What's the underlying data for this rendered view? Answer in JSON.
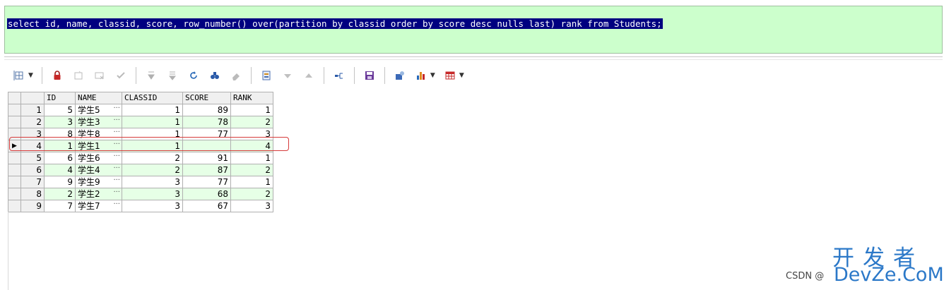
{
  "editor": {
    "sql": "select id, name, classid, score, row_number() over(partition by classid order by score desc nulls last) rank from Students;"
  },
  "toolbar": {
    "icons": [
      "grid-options-icon",
      "lock-icon",
      "insert-record-icon",
      "delete-record-icon",
      "post-check-icon",
      "next-record-icon",
      "last-record-icon",
      "refresh-icon",
      "find-icon",
      "clear-icon",
      "query-by-example-icon",
      "sort-desc-icon",
      "sort-asc-icon",
      "export-icon",
      "save-icon",
      "analyze-icon",
      "chart-icon",
      "table-view-icon"
    ]
  },
  "grid": {
    "columns": [
      "ID",
      "NAME",
      "CLASSID",
      "SCORE",
      "RANK"
    ],
    "ellipsis": "···",
    "current_row_indicator": "▶",
    "rows": [
      {
        "n": "1",
        "id": "5",
        "name": "学生5",
        "classid": "1",
        "score": "89",
        "rank": "1"
      },
      {
        "n": "2",
        "id": "3",
        "name": "学生3",
        "classid": "1",
        "score": "78",
        "rank": "2"
      },
      {
        "n": "3",
        "id": "8",
        "name": "学生8",
        "classid": "1",
        "score": "77",
        "rank": "3"
      },
      {
        "n": "4",
        "id": "1",
        "name": "学生1",
        "classid": "1",
        "score": "",
        "rank": "4"
      },
      {
        "n": "5",
        "id": "6",
        "name": "学生6",
        "classid": "2",
        "score": "91",
        "rank": "1"
      },
      {
        "n": "6",
        "id": "4",
        "name": "学生4",
        "classid": "2",
        "score": "87",
        "rank": "2"
      },
      {
        "n": "7",
        "id": "9",
        "name": "学生9",
        "classid": "3",
        "score": "77",
        "rank": "1"
      },
      {
        "n": "8",
        "id": "2",
        "name": "学生2",
        "classid": "3",
        "score": "68",
        "rank": "2"
      },
      {
        "n": "9",
        "id": "7",
        "name": "学生7",
        "classid": "3",
        "score": "67",
        "rank": "3"
      }
    ]
  },
  "watermark": {
    "chinese": "开发者",
    "url": "DevZe.CoM",
    "csdn": "CSDN @"
  }
}
